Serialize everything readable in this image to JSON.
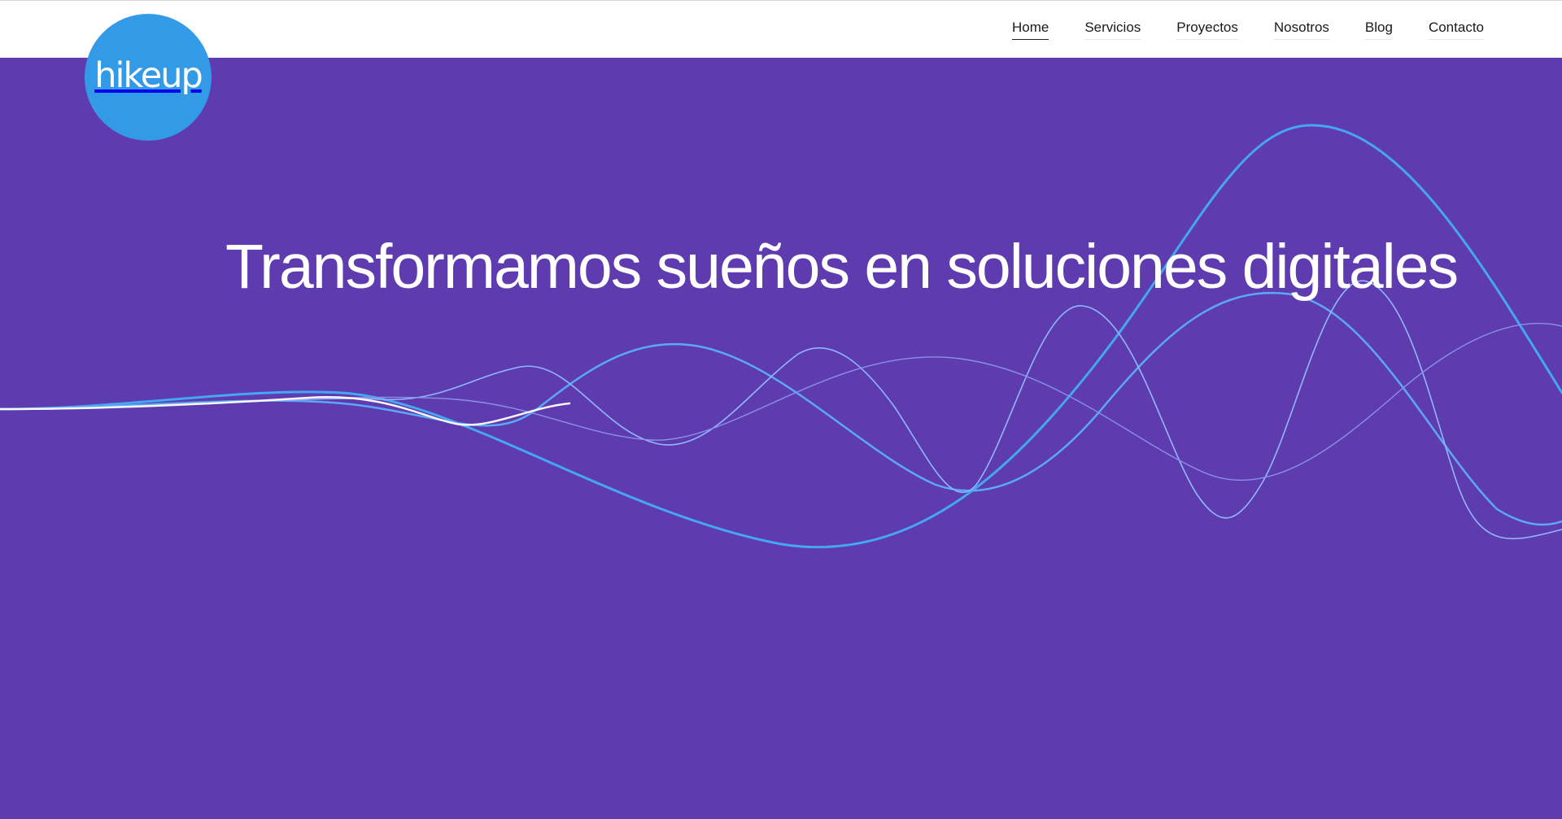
{
  "brand": {
    "logo_text": "hikeup",
    "logo_color": "#339ae8"
  },
  "nav": {
    "items": [
      {
        "label": "Home",
        "active": true
      },
      {
        "label": "Servicios",
        "active": false
      },
      {
        "label": "Proyectos",
        "active": false
      },
      {
        "label": "Nosotros",
        "active": false
      },
      {
        "label": "Blog",
        "active": false
      },
      {
        "label": "Contacto",
        "active": false
      }
    ]
  },
  "hero": {
    "headline": "Transformamos sueños en soluciones digitales",
    "background_color": "#5f3bb0",
    "wave_colors": [
      "#ffffff",
      "#cfe4ff",
      "#7fb4ff",
      "#4aa6f5",
      "#3a9ee8"
    ]
  }
}
